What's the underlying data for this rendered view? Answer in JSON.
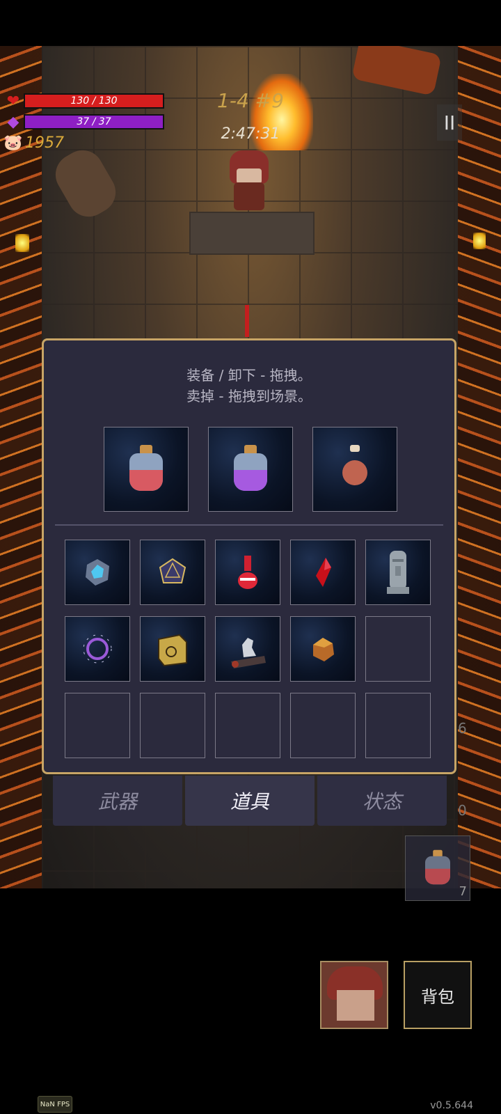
{
  "hud": {
    "hp_text": "130 / 130",
    "hp_fraction": 1.0,
    "mp_text": "37 / 37",
    "mp_fraction": 1.0,
    "gold": "1957",
    "level": "1-4 #9",
    "timer": "2:47:31",
    "pause_icon": "pause-icon"
  },
  "inventory": {
    "hint_line1": "装备 / 卸下 - 拖拽。",
    "hint_line2": "卖掉 - 拖拽到场景。",
    "equipped": [
      {
        "icon": "red-potion-icon"
      },
      {
        "icon": "purple-potion-icon"
      },
      {
        "icon": "clay-pot-potion-icon"
      }
    ],
    "grid": [
      {
        "icon": "blue-gem-cluster-icon"
      },
      {
        "icon": "gold-d20-dice-icon"
      },
      {
        "icon": "red-flask-icon"
      },
      {
        "icon": "red-crystal-icon"
      },
      {
        "icon": "moai-statue-icon"
      },
      {
        "icon": "purple-ring-portal-icon"
      },
      {
        "icon": "gold-rune-cube-icon"
      },
      {
        "icon": "silver-chess-knight-icon"
      },
      {
        "icon": "amber-ore-icon"
      },
      {
        "icon": ""
      },
      {
        "icon": ""
      },
      {
        "icon": ""
      },
      {
        "icon": ""
      },
      {
        "icon": ""
      },
      {
        "icon": ""
      }
    ]
  },
  "tabs": {
    "weapons": "武器",
    "items": "道具",
    "status": "状态"
  },
  "side": {
    "num_a": "6",
    "num_b": "0",
    "potion_count": "7"
  },
  "bottom": {
    "bag_label": "背包",
    "fps": "NaN FPS",
    "version": "v0.5.644"
  },
  "colors": {
    "hp": "#d61e1e",
    "mp": "#8e1fc4",
    "gold_text": "#d9a93a",
    "panel_border": "#c8a566"
  }
}
